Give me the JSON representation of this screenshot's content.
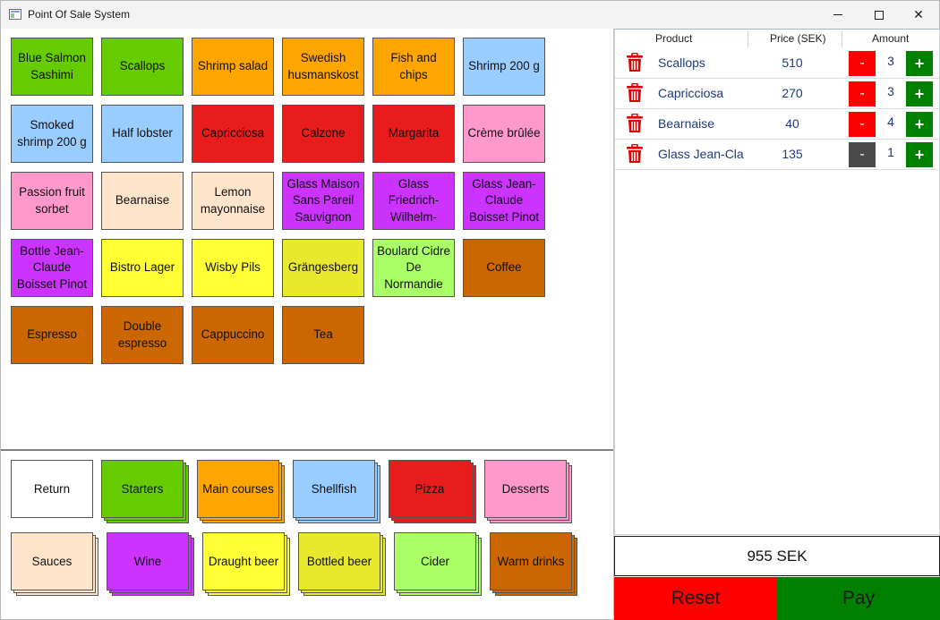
{
  "window": {
    "title": "Point Of Sale System"
  },
  "products": [
    {
      "label": "Blue Salmon Sashimi",
      "color": "#66cc00"
    },
    {
      "label": "Scallops",
      "color": "#66cc00"
    },
    {
      "label": "Shrimp salad",
      "color": "#ffa500"
    },
    {
      "label": "Swedish husmanskost",
      "color": "#ffa500"
    },
    {
      "label": "Fish and chips",
      "color": "#ffa500"
    },
    {
      "label": "Shrimp 200 g",
      "color": "#99ccff"
    },
    {
      "label": "Smoked shrimp 200 g",
      "color": "#99ccff"
    },
    {
      "label": "Half lobster",
      "color": "#99ccff"
    },
    {
      "label": "Capricciosa",
      "color": "#e81c1c"
    },
    {
      "label": "Calzone",
      "color": "#e81c1c"
    },
    {
      "label": "Margarita",
      "color": "#e81c1c"
    },
    {
      "label": "Crème brûlée",
      "color": "#ff99cc"
    },
    {
      "label": "Passion fruit sorbet",
      "color": "#ff99cc"
    },
    {
      "label": "Bearnaise",
      "color": "#ffe4cc"
    },
    {
      "label": "Lemon mayonnaise",
      "color": "#ffe4cc"
    },
    {
      "label": "Glass Maison Sans Pareil Sauvignon",
      "color": "#cc33ff"
    },
    {
      "label": "Glass Friedrich-Wilhelm-",
      "color": "#cc33ff"
    },
    {
      "label": "Glass Jean-Claude Boisset Pinot",
      "color": "#cc33ff"
    },
    {
      "label": "Bottle Jean-Claude Boisset Pinot",
      "color": "#cc33ff"
    },
    {
      "label": "Bistro Lager",
      "color": "#ffff33"
    },
    {
      "label": "Wisby Pils",
      "color": "#ffff33"
    },
    {
      "label": "Grängesberg",
      "color": "#e8e82c"
    },
    {
      "label": "Boulard Cidre De Normandie",
      "color": "#aaff66"
    },
    {
      "label": "Coffee",
      "color": "#cc6600"
    },
    {
      "label": "Espresso",
      "color": "#cc6600"
    },
    {
      "label": "Double espresso",
      "color": "#cc6600"
    },
    {
      "label": "Cappuccino",
      "color": "#cc6600"
    },
    {
      "label": "Tea",
      "color": "#cc6600"
    }
  ],
  "categories": [
    {
      "label": "Return",
      "color": "#ffffff",
      "stacked": false
    },
    {
      "label": "Starters",
      "color": "#66cc00",
      "stacked": true
    },
    {
      "label": "Main courses",
      "color": "#ffa500",
      "stacked": true
    },
    {
      "label": "Shellfish",
      "color": "#99ccff",
      "stacked": true
    },
    {
      "label": "Pizza",
      "color": "#e81c1c",
      "stacked": true
    },
    {
      "label": "Desserts",
      "color": "#ff99cc",
      "stacked": true
    },
    {
      "label": "Sauces",
      "color": "#ffe4cc",
      "stacked": true
    },
    {
      "label": "Wine",
      "color": "#cc33ff",
      "stacked": true
    },
    {
      "label": "Draught beer",
      "color": "#ffff33",
      "stacked": true
    },
    {
      "label": "Bottled beer",
      "color": "#e8e82c",
      "stacked": true
    },
    {
      "label": "Cider",
      "color": "#aaff66",
      "stacked": true
    },
    {
      "label": "Warm drinks",
      "color": "#cc6600",
      "stacked": true
    }
  ],
  "order": {
    "headers": {
      "product": "Product",
      "price": "Price (SEK)",
      "amount": "Amount"
    },
    "rows": [
      {
        "name": "Scallops",
        "price": "510",
        "qty": "3",
        "minus": "-",
        "plus": "+",
        "minus_enabled": true
      },
      {
        "name": "Capricciosa",
        "price": "270",
        "qty": "3",
        "minus": "-",
        "plus": "+",
        "minus_enabled": true
      },
      {
        "name": "Bearnaise",
        "price": "40",
        "qty": "4",
        "minus": "-",
        "plus": "+",
        "minus_enabled": true
      },
      {
        "name": "Glass Jean-Cla",
        "price": "135",
        "qty": "1",
        "minus": "-",
        "plus": "+",
        "minus_enabled": false
      }
    ],
    "total": "955 SEK"
  },
  "actions": {
    "reset": "Reset",
    "pay": "Pay"
  },
  "colors": {
    "minus": "#ff0000",
    "minus_disabled": "#4a4a4a",
    "plus": "#008000",
    "trash": "#e00000"
  }
}
